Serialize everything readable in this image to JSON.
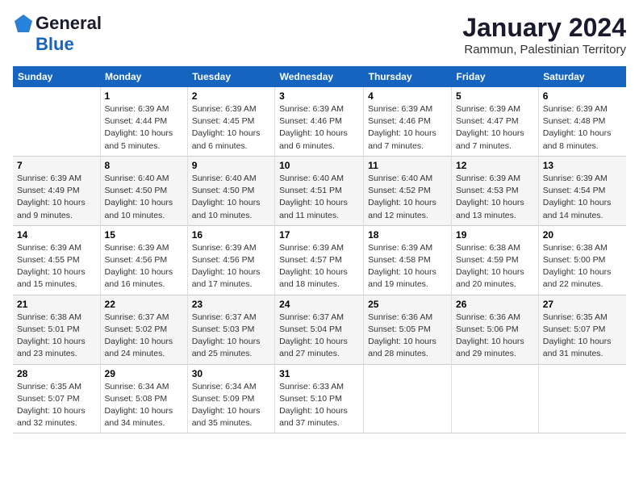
{
  "logo": {
    "general": "General",
    "blue": "Blue"
  },
  "title": "January 2024",
  "subtitle": "Rammun, Palestinian Territory",
  "days_header": [
    "Sunday",
    "Monday",
    "Tuesday",
    "Wednesday",
    "Thursday",
    "Friday",
    "Saturday"
  ],
  "weeks": [
    [
      {
        "day": "",
        "info": ""
      },
      {
        "day": "1",
        "info": "Sunrise: 6:39 AM\nSunset: 4:44 PM\nDaylight: 10 hours\nand 5 minutes."
      },
      {
        "day": "2",
        "info": "Sunrise: 6:39 AM\nSunset: 4:45 PM\nDaylight: 10 hours\nand 6 minutes."
      },
      {
        "day": "3",
        "info": "Sunrise: 6:39 AM\nSunset: 4:46 PM\nDaylight: 10 hours\nand 6 minutes."
      },
      {
        "day": "4",
        "info": "Sunrise: 6:39 AM\nSunset: 4:46 PM\nDaylight: 10 hours\nand 7 minutes."
      },
      {
        "day": "5",
        "info": "Sunrise: 6:39 AM\nSunset: 4:47 PM\nDaylight: 10 hours\nand 7 minutes."
      },
      {
        "day": "6",
        "info": "Sunrise: 6:39 AM\nSunset: 4:48 PM\nDaylight: 10 hours\nand 8 minutes."
      }
    ],
    [
      {
        "day": "7",
        "info": "Sunrise: 6:39 AM\nSunset: 4:49 PM\nDaylight: 10 hours\nand 9 minutes."
      },
      {
        "day": "8",
        "info": "Sunrise: 6:40 AM\nSunset: 4:50 PM\nDaylight: 10 hours\nand 10 minutes."
      },
      {
        "day": "9",
        "info": "Sunrise: 6:40 AM\nSunset: 4:50 PM\nDaylight: 10 hours\nand 10 minutes."
      },
      {
        "day": "10",
        "info": "Sunrise: 6:40 AM\nSunset: 4:51 PM\nDaylight: 10 hours\nand 11 minutes."
      },
      {
        "day": "11",
        "info": "Sunrise: 6:40 AM\nSunset: 4:52 PM\nDaylight: 10 hours\nand 12 minutes."
      },
      {
        "day": "12",
        "info": "Sunrise: 6:39 AM\nSunset: 4:53 PM\nDaylight: 10 hours\nand 13 minutes."
      },
      {
        "day": "13",
        "info": "Sunrise: 6:39 AM\nSunset: 4:54 PM\nDaylight: 10 hours\nand 14 minutes."
      }
    ],
    [
      {
        "day": "14",
        "info": "Sunrise: 6:39 AM\nSunset: 4:55 PM\nDaylight: 10 hours\nand 15 minutes."
      },
      {
        "day": "15",
        "info": "Sunrise: 6:39 AM\nSunset: 4:56 PM\nDaylight: 10 hours\nand 16 minutes."
      },
      {
        "day": "16",
        "info": "Sunrise: 6:39 AM\nSunset: 4:56 PM\nDaylight: 10 hours\nand 17 minutes."
      },
      {
        "day": "17",
        "info": "Sunrise: 6:39 AM\nSunset: 4:57 PM\nDaylight: 10 hours\nand 18 minutes."
      },
      {
        "day": "18",
        "info": "Sunrise: 6:39 AM\nSunset: 4:58 PM\nDaylight: 10 hours\nand 19 minutes."
      },
      {
        "day": "19",
        "info": "Sunrise: 6:38 AM\nSunset: 4:59 PM\nDaylight: 10 hours\nand 20 minutes."
      },
      {
        "day": "20",
        "info": "Sunrise: 6:38 AM\nSunset: 5:00 PM\nDaylight: 10 hours\nand 22 minutes."
      }
    ],
    [
      {
        "day": "21",
        "info": "Sunrise: 6:38 AM\nSunset: 5:01 PM\nDaylight: 10 hours\nand 23 minutes."
      },
      {
        "day": "22",
        "info": "Sunrise: 6:37 AM\nSunset: 5:02 PM\nDaylight: 10 hours\nand 24 minutes."
      },
      {
        "day": "23",
        "info": "Sunrise: 6:37 AM\nSunset: 5:03 PM\nDaylight: 10 hours\nand 25 minutes."
      },
      {
        "day": "24",
        "info": "Sunrise: 6:37 AM\nSunset: 5:04 PM\nDaylight: 10 hours\nand 27 minutes."
      },
      {
        "day": "25",
        "info": "Sunrise: 6:36 AM\nSunset: 5:05 PM\nDaylight: 10 hours\nand 28 minutes."
      },
      {
        "day": "26",
        "info": "Sunrise: 6:36 AM\nSunset: 5:06 PM\nDaylight: 10 hours\nand 29 minutes."
      },
      {
        "day": "27",
        "info": "Sunrise: 6:35 AM\nSunset: 5:07 PM\nDaylight: 10 hours\nand 31 minutes."
      }
    ],
    [
      {
        "day": "28",
        "info": "Sunrise: 6:35 AM\nSunset: 5:07 PM\nDaylight: 10 hours\nand 32 minutes."
      },
      {
        "day": "29",
        "info": "Sunrise: 6:34 AM\nSunset: 5:08 PM\nDaylight: 10 hours\nand 34 minutes."
      },
      {
        "day": "30",
        "info": "Sunrise: 6:34 AM\nSunset: 5:09 PM\nDaylight: 10 hours\nand 35 minutes."
      },
      {
        "day": "31",
        "info": "Sunrise: 6:33 AM\nSunset: 5:10 PM\nDaylight: 10 hours\nand 37 minutes."
      },
      {
        "day": "",
        "info": ""
      },
      {
        "day": "",
        "info": ""
      },
      {
        "day": "",
        "info": ""
      }
    ]
  ]
}
